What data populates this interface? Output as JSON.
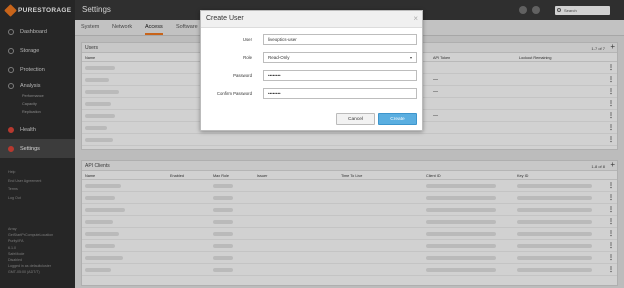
{
  "app": {
    "logo_text": "PURESTORAGE",
    "page_title": "Settings"
  },
  "header": {
    "search_placeholder": "Search"
  },
  "sidebar": {
    "items": [
      {
        "label": "Dashboard",
        "icon": "dashboard-icon"
      },
      {
        "label": "Storage",
        "icon": "storage-icon"
      },
      {
        "label": "Protection",
        "icon": "protection-icon"
      },
      {
        "label": "Analysis",
        "icon": "analysis-icon"
      },
      {
        "label": "Health",
        "icon": "health-icon"
      },
      {
        "label": "Settings",
        "icon": "settings-icon"
      }
    ],
    "analysis_sub": [
      "Performance",
      "Capacity",
      "Replication"
    ],
    "links": [
      "Help",
      "End User Agreement",
      "Terms",
      "Log Out"
    ],
    "info": [
      "Array",
      "GetStartPrComputeLocation",
      "Purity//FA",
      "6.1.0",
      "SafeMode",
      "Disabled",
      "Logged in as defaultcluster",
      "GMT-05:00 (ADT/T)"
    ]
  },
  "tabs": [
    "System",
    "Network",
    "Access",
    "Software"
  ],
  "users_panel": {
    "title": "Users",
    "count": "1-7 of 7",
    "columns": [
      "Name",
      "API Token",
      "Lockout Remaining"
    ],
    "rows": 7
  },
  "api_panel": {
    "title": "API Clients",
    "count": "1-8 of 8",
    "columns": [
      "Name",
      "Enabled",
      "Max Role",
      "Issuer",
      "Time To Live",
      "Client ID",
      "Key ID"
    ],
    "rows": 8
  },
  "modal": {
    "title": "Create User",
    "user_label": "User",
    "user_value": "liveoptics-user",
    "role_label": "Role",
    "role_value": "Read-Only",
    "password_label": "Password",
    "password_value": "••••••••",
    "confirm_label": "Confirm Password",
    "confirm_value": "••••••••",
    "cancel_label": "Cancel",
    "create_label": "Create"
  },
  "colors": {
    "accent": "#f47b20",
    "primary_button": "#5aaee0",
    "sidebar_bg": "#2f2f2f"
  }
}
